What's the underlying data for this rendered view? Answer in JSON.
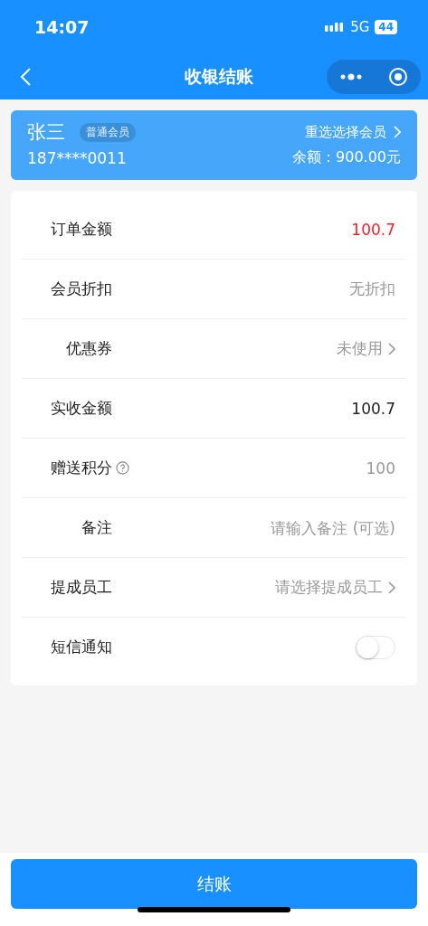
{
  "status_bar": {
    "time": "14:07",
    "network": "5G",
    "battery": "44"
  },
  "nav": {
    "title": "收银结账"
  },
  "member": {
    "name": "张三",
    "tier": "普通会员",
    "phone": "187****0011",
    "change_link": "重选选择会员",
    "balance": "余额：900.00元"
  },
  "rows": [
    {
      "kind": "value",
      "label": "订单金额",
      "value": "100.7",
      "color": "#f5222d"
    },
    {
      "kind": "value",
      "label": "会员折扣",
      "value": "无折扣",
      "color": "#999999"
    },
    {
      "kind": "link",
      "label": "优惠券",
      "value": "未使用"
    },
    {
      "kind": "value",
      "label": "实收金额",
      "value": "100.7",
      "color": "#222222"
    },
    {
      "kind": "value",
      "label": "赠送积分",
      "value": "100",
      "color": "#999999",
      "help": true
    },
    {
      "kind": "input",
      "label": "备注",
      "placeholder": "请输入备注 (可选)"
    },
    {
      "kind": "link",
      "label": "提成员工",
      "value": "请选择提成员工"
    },
    {
      "kind": "toggle",
      "label": "短信通知",
      "on": false
    }
  ],
  "submit": {
    "label": "结账"
  }
}
